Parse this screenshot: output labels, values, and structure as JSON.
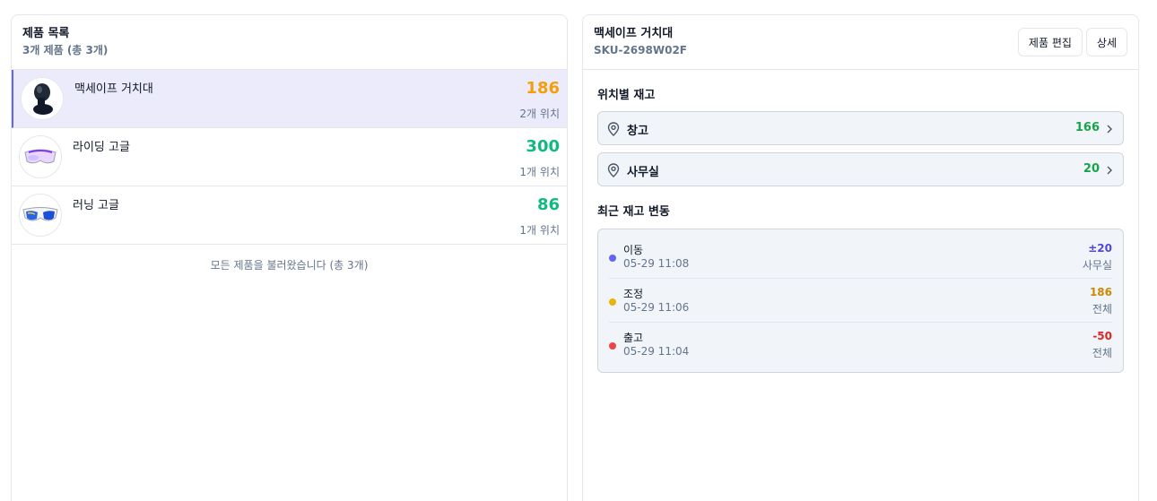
{
  "list": {
    "title": "제품 목록",
    "subtitle": "3개 제품 (총 3개)",
    "footer": "모든 제품을 불러왔습니다 (총 3개)",
    "items": [
      {
        "name": "맥세이프 거치대",
        "qty": "186",
        "locations": "2개 위치",
        "thumb": "magsafe-holder-image",
        "qty_color": "#f59e0b"
      },
      {
        "name": "라이딩 고글",
        "qty": "300",
        "locations": "1개 위치",
        "thumb": "riding-goggle-image",
        "qty_color": "#10b981"
      },
      {
        "name": "러닝 고글",
        "qty": "86",
        "locations": "1개 위치",
        "thumb": "running-goggle-image",
        "qty_color": "#10b981"
      }
    ]
  },
  "detail": {
    "title": "맥세이프 거치대",
    "sku": "SKU-2698W02F",
    "edit_label": "제품 편집",
    "detail_label": "상세",
    "stock_by_location_title": "위치별 재고",
    "locations": [
      {
        "name": "창고",
        "qty": "166"
      },
      {
        "name": "사무실",
        "qty": "20"
      }
    ],
    "recent_changes_title": "최근 재고 변동",
    "changes": [
      {
        "type": "이동",
        "time": "05-29 11:08",
        "value": "±20",
        "location": "사무실",
        "color": "#6366f1",
        "value_color": "#4f46e5"
      },
      {
        "type": "조정",
        "time": "05-29 11:06",
        "value": "186",
        "location": "전체",
        "color": "#eab308",
        "value_color": "#ca8a04"
      },
      {
        "type": "출고",
        "time": "05-29 11:04",
        "value": "-50",
        "location": "전체",
        "color": "#ef4444",
        "value_color": "#dc2626"
      }
    ]
  }
}
